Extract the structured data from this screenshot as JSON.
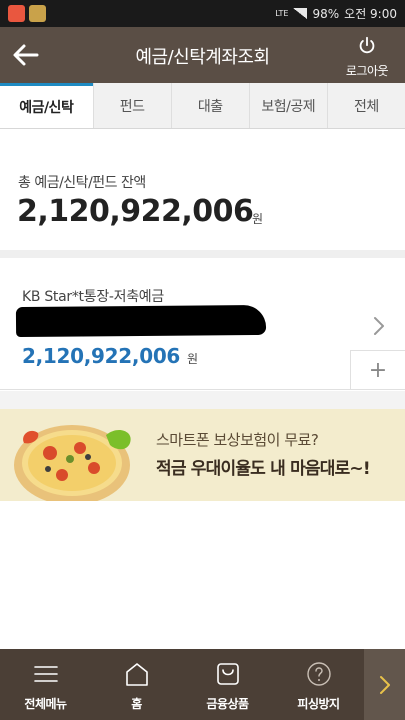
{
  "status_bar": {
    "network": "LTE",
    "battery": "98%",
    "time": "오전 9:00"
  },
  "header": {
    "title": "예금/신탁계좌조회",
    "logout_label": "로그아웃"
  },
  "tabs": [
    {
      "label": "예금/신탁",
      "active": true
    },
    {
      "label": "펀드",
      "active": false
    },
    {
      "label": "대출",
      "active": false
    },
    {
      "label": "보험/공제",
      "active": false
    },
    {
      "label": "전체",
      "active": false
    }
  ],
  "summary": {
    "label": "총 예금/신탁/펀드 잔액",
    "amount": "2,120,922,006",
    "unit": "원"
  },
  "account": {
    "name": "KB Star*t통장-저축예금",
    "amount": "2,120,922,006",
    "unit": "원",
    "add_label": "+"
  },
  "banner": {
    "line1": "스마트폰 보상보험이 무료?",
    "line2": "적금 우대이율도 내 마음대로~!"
  },
  "bottom_nav": [
    {
      "label": "전체메뉴",
      "icon": "menu-icon"
    },
    {
      "label": "홈",
      "icon": "home-icon"
    },
    {
      "label": "금융상품",
      "icon": "shopping-bag-icon"
    },
    {
      "label": "피싱방지",
      "icon": "help-circle-icon"
    }
  ],
  "colors": {
    "header_bg": "#5a4e45",
    "nav_bg": "#4b3f36",
    "active_tab_accent": "#1e8bc3",
    "amount_blue": "#2473b6",
    "banner_bg": "#f3eccd"
  }
}
